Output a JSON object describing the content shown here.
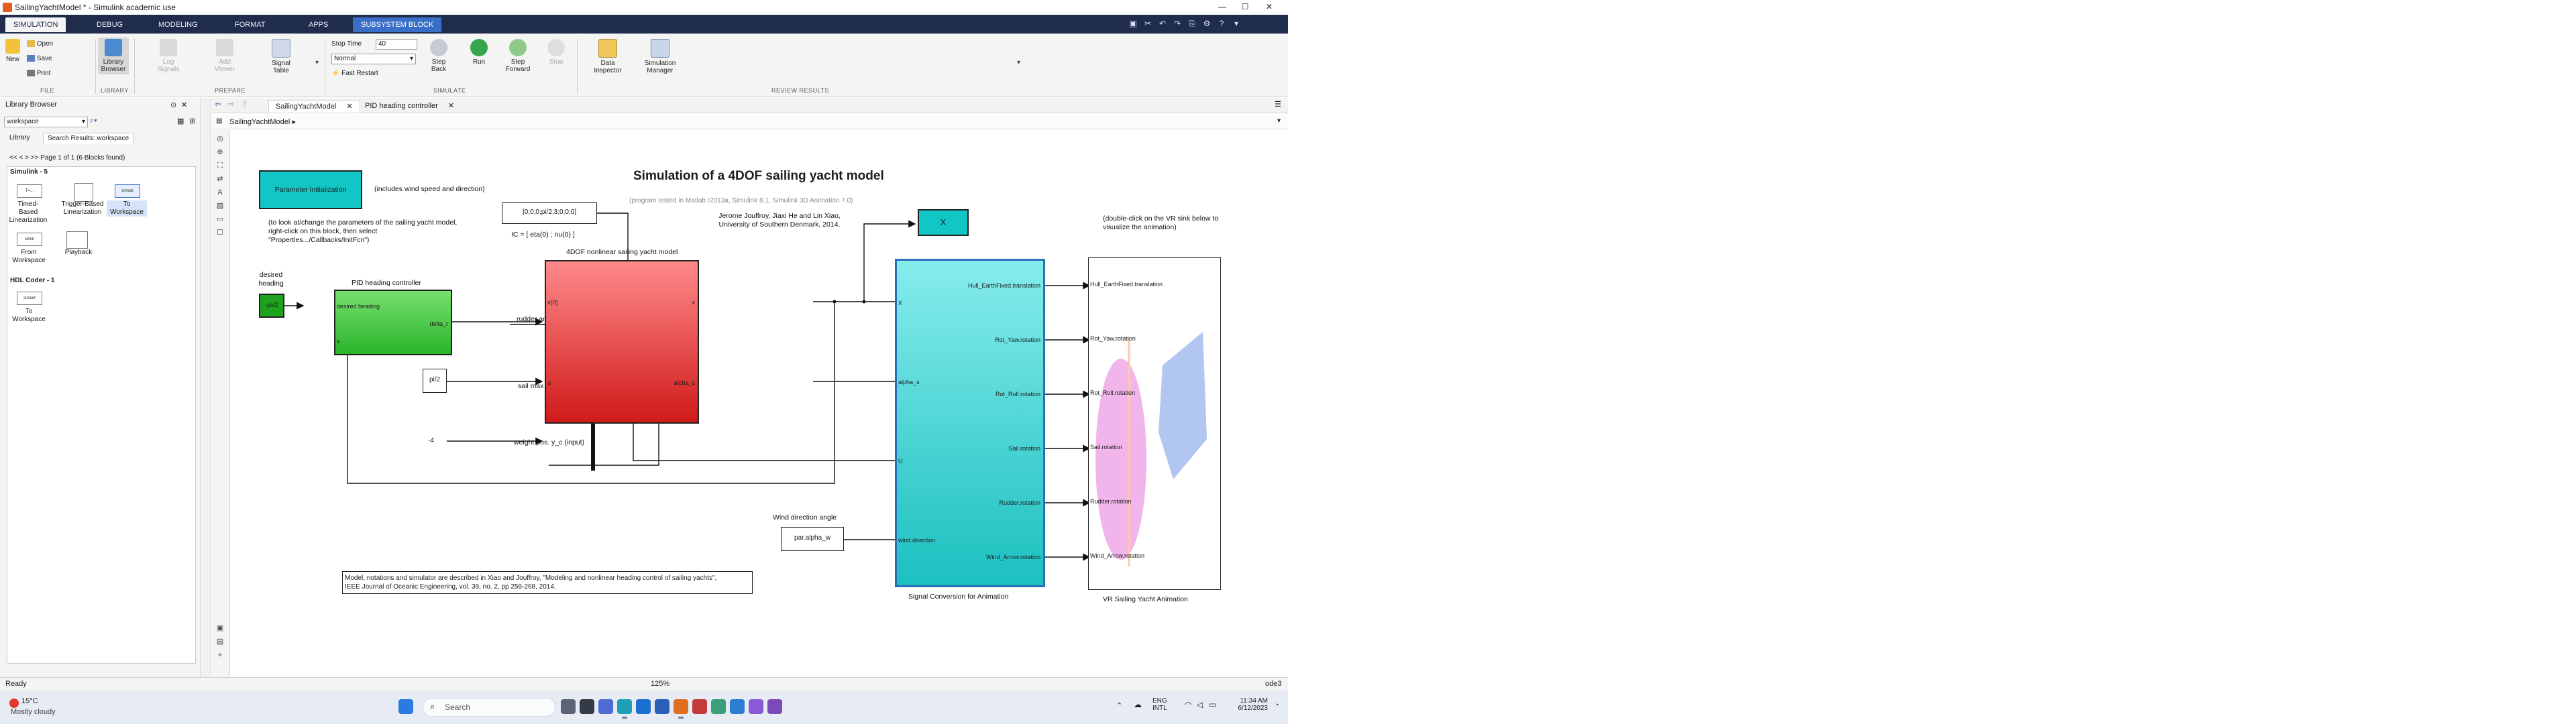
{
  "window": {
    "title": "SailingYachtModel * - Simulink academic use"
  },
  "tabs": [
    "SIMULATION",
    "DEBUG",
    "MODELING",
    "FORMAT",
    "APPS",
    "SUBSYSTEM BLOCK"
  ],
  "ribbon": {
    "file": {
      "new": "New",
      "open": "Open",
      "save": "Save",
      "print": "Print",
      "group": "FILE"
    },
    "library": {
      "browser_line1": "Library",
      "browser_line2": "Browser",
      "group": "LIBRARY"
    },
    "prepare": {
      "log_line1": "Log",
      "log_line2": "Signals",
      "viewer_line1": "Add",
      "viewer_line2": "Viewer",
      "table_line1": "Signal",
      "table_line2": "Table",
      "group": "PREPARE"
    },
    "simulate": {
      "stop_time_label": "Stop Time",
      "stop_time_value": "40",
      "mode": "Normal",
      "fast_restart": "Fast Restart",
      "step_back_line1": "Step",
      "step_back_line2": "Back",
      "run": "Run",
      "step_fwd_line1": "Step",
      "step_fwd_line2": "Forward",
      "stop": "Stop",
      "group": "SIMULATE"
    },
    "review": {
      "inspector_line1": "Data",
      "inspector_line2": "Inspector",
      "manager_line1": "Simulation",
      "manager_line2": "Manager",
      "group": "REVIEW RESULTS"
    }
  },
  "library": {
    "title": "Library Browser",
    "search_value": "workspace",
    "tabs": [
      "Library",
      "Search Results: workspace"
    ],
    "page_info": "<< < > >> Page 1 of 1 (6 Blocks found)",
    "simulink_header": "Simulink - 5",
    "simulink_blocks": [
      {
        "name": "Timed-Based Linearization",
        "thumb": "T=..."
      },
      {
        "name": "Trigger-Based Linearization",
        "thumb": ""
      },
      {
        "name": "To Workspace",
        "thumb": "simout"
      },
      {
        "name": "From Workspace",
        "thumb": "simin"
      },
      {
        "name": "Playback",
        "thumb": ""
      }
    ],
    "hdl_header": "HDL Coder - 1",
    "hdl_blocks": [
      {
        "name": "To Workspace",
        "thumb": "simout"
      }
    ]
  },
  "editor": {
    "tabs": [
      "SailingYachtModel",
      "PID heading controller"
    ],
    "breadcrumb": "SailingYachtModel",
    "zoom": "125%"
  },
  "diagram": {
    "title": "Simulation of a 4DOF sailing yacht model",
    "subtitle": "(program tested in Matlab r2013a, Simulink 8.1, Simulink 3D Animation 7.0)",
    "authors_line1": "Jerome Jouffroy, Jiaxi He and Lin Xiao,",
    "authors_line2": "University of Southern Denmark, 2014.",
    "param_block": "Parameter Initialization",
    "param_note1": "(includes wind speed and direction)",
    "param_note2": "(to look at/change the parameters of the sailing yacht model, right-click on this block, then select \"Properties.../Callbacks/InitFcn\")",
    "ic_value": "[0;0;0;pi/2;3;0;0;0]",
    "ic_label": "IC = [ eta(0) ; nu(0) ]",
    "x_block": "X",
    "vr_note": "(double-click on the VR sink below to visualize the animation)",
    "desired_heading_line1": "desired",
    "desired_heading_line2": "heading",
    "const_heading": "-pi/2",
    "pid_label": "PID heading controller",
    "pid_in1": "desired heading",
    "pid_in2": "x",
    "pid_out": "delta_r",
    "rudder_label": "rudder ang. delta_r (input)",
    "sail_const": "pi/2",
    "sail_label": "sail max ang. delta_sbar (input)",
    "weight_const": "-4",
    "weight_label": "weight pos. y_c (input)",
    "model_label": "4DOF nonlinear sailing yacht model",
    "model_in1": "x(0)",
    "model_in2": "u",
    "model_out1": "x",
    "model_out2": "alpha_s",
    "conv_in1": "X",
    "conv_in2": "alpha_s",
    "conv_in3": "U",
    "conv_in4": "wind direction",
    "conv_outs": [
      "Hull_EarthFixed.translation",
      "Rot_Yaw.rotation",
      "Rot_Roll.rotation",
      "Sail.rotation",
      "Rudder.rotation",
      "Wind_Arrow.rotation"
    ],
    "conv_label": "Signal Conversion for Animation",
    "vr_inputs": [
      "Hull_EarthFixed.translation",
      "Rot_Yaw.rotation",
      "Rot_Roll.rotation",
      "Sail.rotation",
      "Rudder.rotation",
      "Wind_Arrow.rotation"
    ],
    "vr_label": "VR Sailing Yacht Animation",
    "wind_label": "Wind direction angle",
    "wind_const": "par.alpha_w",
    "ref_line1": "Model, notations and simulator are described in Xiao and Jouffroy, \"Modeling and nonlinear heading control of sailing yachts\",",
    "ref_line2": "IEEE Journal of Oceanic Engineering, vol. 39, no. 2, pp 256-268, 2014."
  },
  "status": {
    "left": "Ready",
    "zoom": "125%",
    "solver": "ode3"
  },
  "taskbar": {
    "weather_temp": "15°C",
    "weather_desc": "Mostly cloudy",
    "search_placeholder": "Search",
    "lang_line1": "ENG",
    "lang_line2": "INTL",
    "time": "11:34 AM",
    "date": "6/12/2023"
  }
}
